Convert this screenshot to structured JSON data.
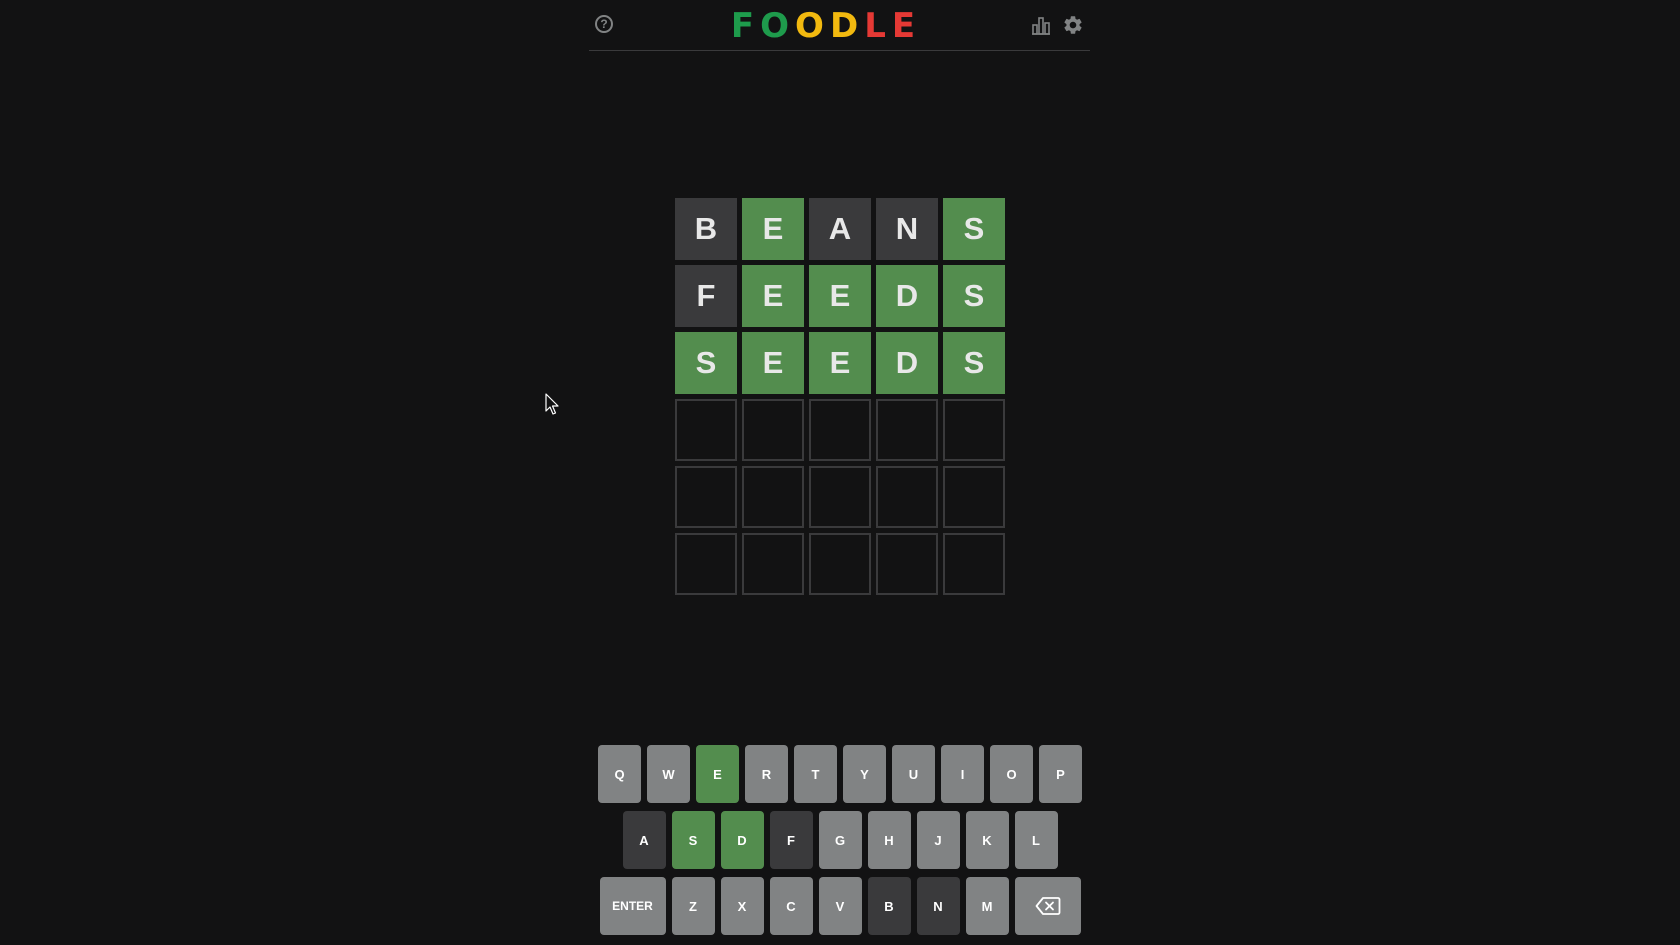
{
  "header": {
    "help_glyph": "?",
    "logo_letters": [
      {
        "char": "F",
        "color": "#1e9b4c"
      },
      {
        "char": "O",
        "color": "#1e9b4c"
      },
      {
        "char": "O",
        "color": "#f2b90f"
      },
      {
        "char": "D",
        "color": "#f2b90f"
      },
      {
        "char": "L",
        "color": "#e53935"
      },
      {
        "char": "E",
        "color": "#e53935"
      }
    ],
    "stats_icon": "bar-chart-icon",
    "settings_icon": "gear-icon"
  },
  "board": {
    "rows": [
      [
        {
          "letter": "B",
          "state": "absent"
        },
        {
          "letter": "E",
          "state": "correct"
        },
        {
          "letter": "A",
          "state": "absent"
        },
        {
          "letter": "N",
          "state": "absent"
        },
        {
          "letter": "S",
          "state": "correct"
        }
      ],
      [
        {
          "letter": "F",
          "state": "absent"
        },
        {
          "letter": "E",
          "state": "correct"
        },
        {
          "letter": "E",
          "state": "correct"
        },
        {
          "letter": "D",
          "state": "correct"
        },
        {
          "letter": "S",
          "state": "correct"
        }
      ],
      [
        {
          "letter": "S",
          "state": "correct"
        },
        {
          "letter": "E",
          "state": "correct"
        },
        {
          "letter": "E",
          "state": "correct"
        },
        {
          "letter": "D",
          "state": "correct"
        },
        {
          "letter": "S",
          "state": "correct"
        }
      ],
      [
        {
          "letter": "",
          "state": "empty"
        },
        {
          "letter": "",
          "state": "empty"
        },
        {
          "letter": "",
          "state": "empty"
        },
        {
          "letter": "",
          "state": "empty"
        },
        {
          "letter": "",
          "state": "empty"
        }
      ],
      [
        {
          "letter": "",
          "state": "empty"
        },
        {
          "letter": "",
          "state": "empty"
        },
        {
          "letter": "",
          "state": "empty"
        },
        {
          "letter": "",
          "state": "empty"
        },
        {
          "letter": "",
          "state": "empty"
        }
      ],
      [
        {
          "letter": "",
          "state": "empty"
        },
        {
          "letter": "",
          "state": "empty"
        },
        {
          "letter": "",
          "state": "empty"
        },
        {
          "letter": "",
          "state": "empty"
        },
        {
          "letter": "",
          "state": "empty"
        }
      ]
    ]
  },
  "keyboard": {
    "rows": [
      [
        {
          "key": "Q",
          "state": "unused"
        },
        {
          "key": "W",
          "state": "unused"
        },
        {
          "key": "E",
          "state": "correct"
        },
        {
          "key": "R",
          "state": "unused"
        },
        {
          "key": "T",
          "state": "unused"
        },
        {
          "key": "Y",
          "state": "unused"
        },
        {
          "key": "U",
          "state": "unused"
        },
        {
          "key": "I",
          "state": "unused"
        },
        {
          "key": "O",
          "state": "unused"
        },
        {
          "key": "P",
          "state": "unused"
        }
      ],
      [
        {
          "key": "A",
          "state": "absent"
        },
        {
          "key": "S",
          "state": "correct"
        },
        {
          "key": "D",
          "state": "correct"
        },
        {
          "key": "F",
          "state": "absent"
        },
        {
          "key": "G",
          "state": "unused"
        },
        {
          "key": "H",
          "state": "unused"
        },
        {
          "key": "J",
          "state": "unused"
        },
        {
          "key": "K",
          "state": "unused"
        },
        {
          "key": "L",
          "state": "unused"
        }
      ],
      [
        {
          "key": "ENTER",
          "state": "unused",
          "wide": true
        },
        {
          "key": "Z",
          "state": "unused"
        },
        {
          "key": "X",
          "state": "unused"
        },
        {
          "key": "C",
          "state": "unused"
        },
        {
          "key": "V",
          "state": "unused"
        },
        {
          "key": "B",
          "state": "absent"
        },
        {
          "key": "N",
          "state": "absent"
        },
        {
          "key": "M",
          "state": "unused"
        },
        {
          "key": "",
          "state": "unused",
          "wide": true,
          "icon": "backspace-icon"
        }
      ]
    ]
  },
  "colors": {
    "correct": "#538d4e",
    "absent": "#3a3a3c",
    "unused": "#818384",
    "background": "#121213"
  }
}
